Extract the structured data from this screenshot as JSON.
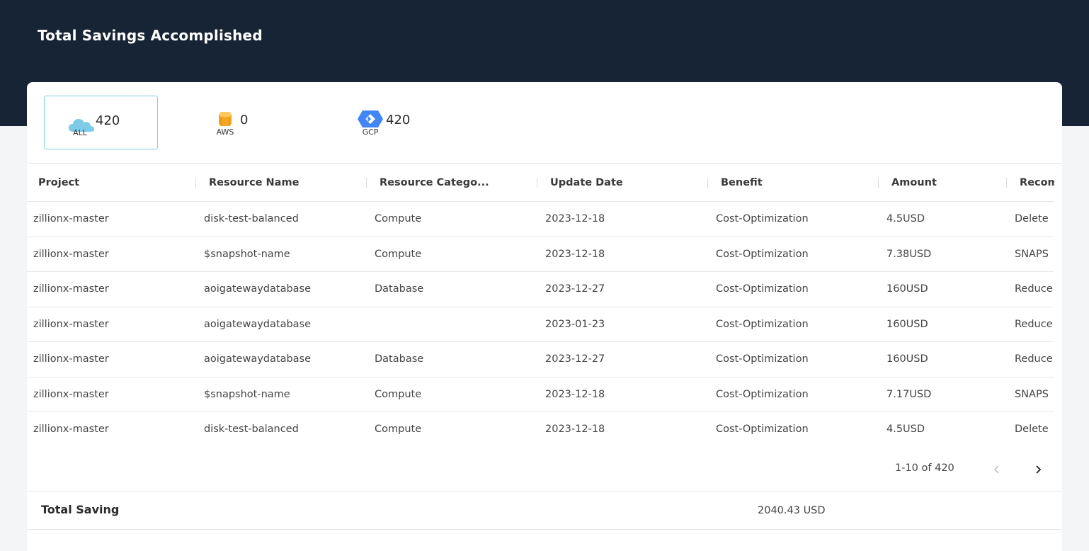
{
  "page": {
    "title": "Total Savings Accomplished"
  },
  "providers": [
    {
      "label": "ALL",
      "count": "420",
      "icon": "cloud-icon",
      "active": true
    },
    {
      "label": "AWS",
      "count": "0",
      "icon": "aws-cube-icon",
      "active": false
    },
    {
      "label": "GCP",
      "count": "420",
      "icon": "gcp-hexagon-icon",
      "active": false
    }
  ],
  "table": {
    "columns": [
      "Project",
      "Resource Name",
      "Resource Catego...",
      "Update Date",
      "Benefit",
      "Amount",
      "Recomm"
    ],
    "rows": [
      [
        "zillionx-master",
        "disk-test-balanced",
        "Compute",
        "2023-12-18",
        "Cost-Optimization",
        "4.5USD",
        "Delete"
      ],
      [
        "zillionx-master",
        "$snapshot-name",
        "Compute",
        "2023-12-18",
        "Cost-Optimization",
        "7.38USD",
        "SNAPS"
      ],
      [
        "zillionx-master",
        "aoigatewaydatabase",
        "Database",
        "2023-12-27",
        "Cost-Optimization",
        "160USD",
        "Reduce"
      ],
      [
        "zillionx-master",
        "aoigatewaydatabase",
        "",
        "2023-01-23",
        "Cost-Optimization",
        "160USD",
        "Reduce"
      ],
      [
        "zillionx-master",
        "aoigatewaydatabase",
        "Database",
        "2023-12-27",
        "Cost-Optimization",
        "160USD",
        "Reduce"
      ],
      [
        "zillionx-master",
        "$snapshot-name",
        "Compute",
        "2023-12-18",
        "Cost-Optimization",
        "7.17USD",
        "SNAPS"
      ],
      [
        "zillionx-master",
        "disk-test-balanced",
        "Compute",
        "2023-12-18",
        "Cost-Optimization",
        "4.5USD",
        "Delete"
      ]
    ]
  },
  "pagination": {
    "range": "1-10 of 420"
  },
  "total": {
    "label": "Total Saving",
    "value": "2040.43 USD"
  },
  "colors": {
    "header": "#172435",
    "accent": "#7fd0e0",
    "aws": "#f5a623",
    "gcp": "#4285f4",
    "cloud": "#7ecbe8"
  }
}
